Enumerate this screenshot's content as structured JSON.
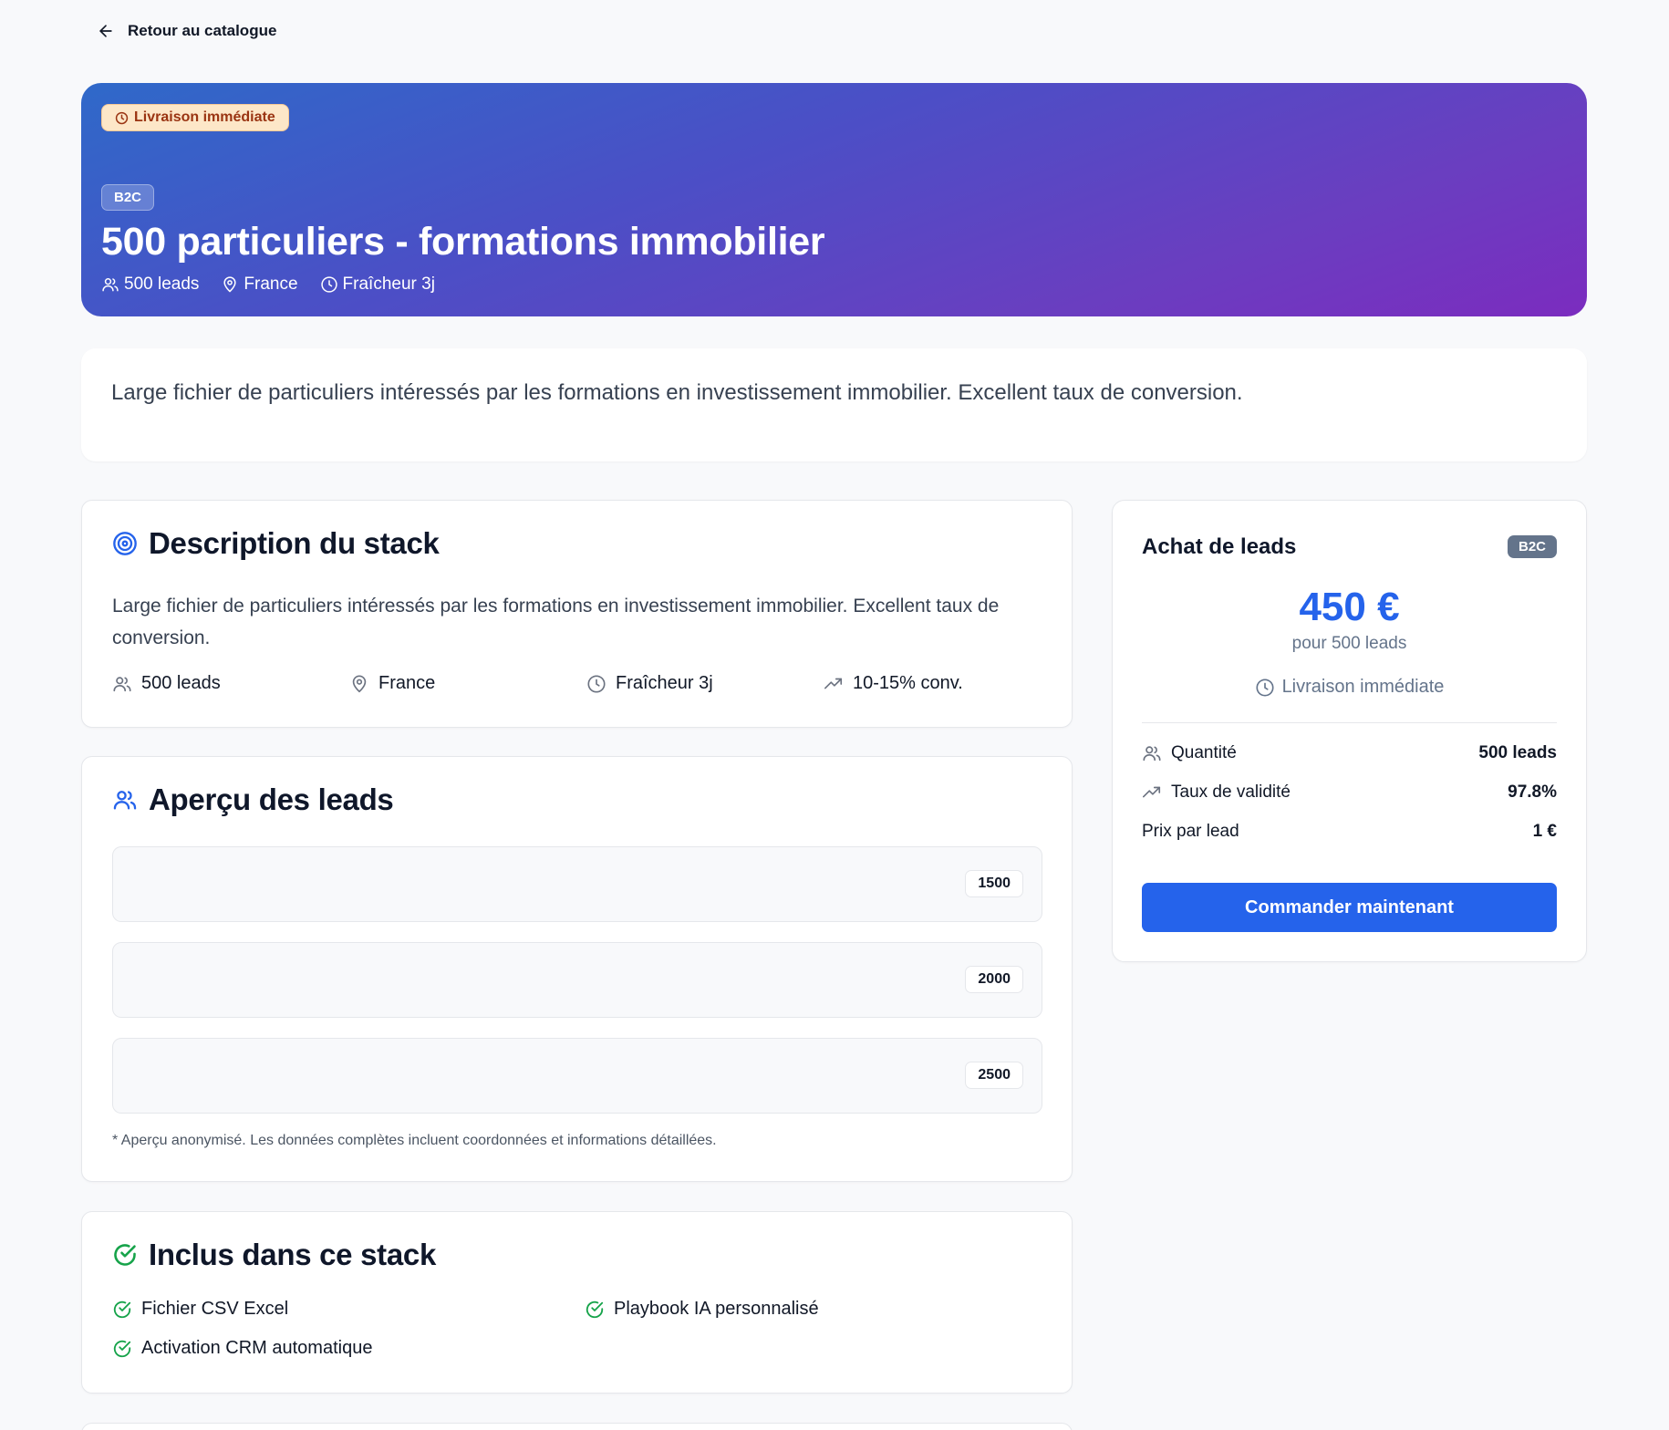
{
  "nav": {
    "back_label": "Retour au catalogue"
  },
  "hero": {
    "delivery_badge": "Livraison immédiate",
    "segment_badge": "B2C",
    "title": "500 particuliers - formations immobilier",
    "meta": {
      "leads": "500 leads",
      "location": "France",
      "freshness": "Fraîcheur 3j"
    }
  },
  "summary": {
    "text": "Large fichier de particuliers intéressés par les formations en investissement immobilier. Excellent taux de conversion."
  },
  "description": {
    "title": "Description du stack",
    "text": "Large fichier de particuliers intéressés par les formations en investissement immobilier. Excellent taux de conversion.",
    "stats": {
      "leads": "500 leads",
      "location": "France",
      "freshness": "Fraîcheur 3j",
      "conversion": "10-15% conv."
    }
  },
  "preview": {
    "title": "Aperçu des leads",
    "rows": [
      {
        "tag": "1500"
      },
      {
        "tag": "2000"
      },
      {
        "tag": "2500"
      }
    ],
    "note": "* Aperçu anonymisé. Les données complètes incluent coordonnées et informations détaillées."
  },
  "included": {
    "title": "Inclus dans ce stack",
    "items": [
      "Fichier CSV Excel",
      "Playbook IA personnalisé",
      "Activation CRM automatique"
    ]
  },
  "purchase": {
    "title": "Achat de leads",
    "badge": "B2C",
    "price": "450 €",
    "price_sub": "pour 500 leads",
    "delivery": "Livraison immédiate",
    "rows": [
      {
        "label": "Quantité",
        "value": "500 leads"
      },
      {
        "label": "Taux de validité",
        "value": "97.8%"
      },
      {
        "label": "Prix par lead",
        "value": "1 €"
      }
    ],
    "cta": "Commander maintenant"
  },
  "colors": {
    "accent": "#2563eb",
    "hero_gradient_start": "#2f69c9",
    "hero_gradient_end": "#7b2cbf",
    "success": "#16a34a",
    "delivery_badge_bg": "#fde7c8",
    "delivery_badge_text": "#9a3412"
  },
  "icons": {
    "back": "arrow-left-icon",
    "users": "users-icon",
    "location": "map-pin-icon",
    "clock": "clock-icon",
    "trend": "trending-up-icon",
    "target": "target-icon",
    "check": "check-circle-icon"
  }
}
